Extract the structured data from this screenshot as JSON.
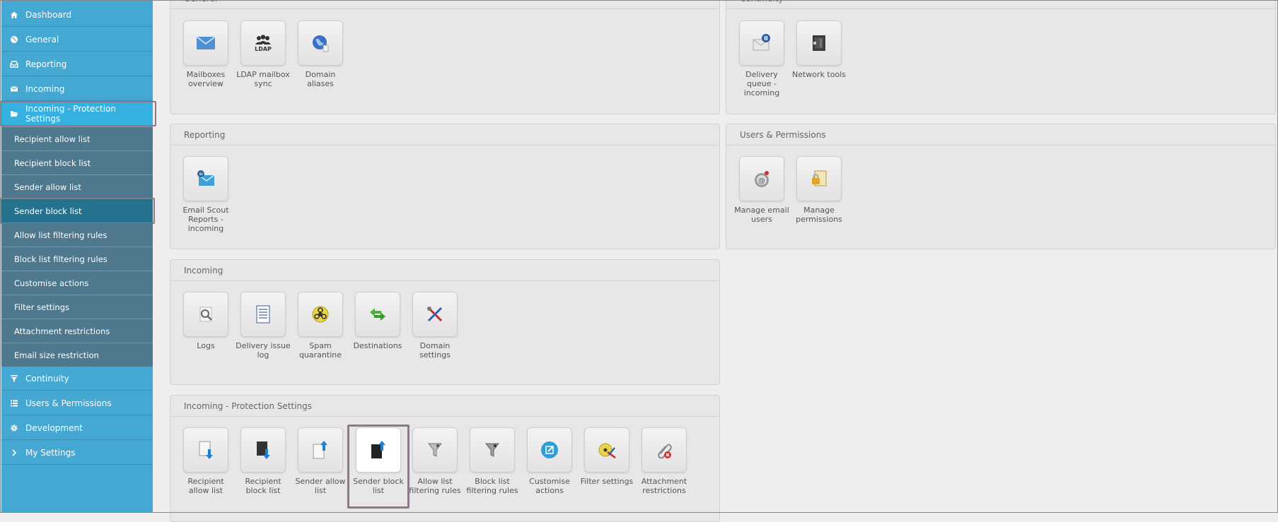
{
  "sidebar": {
    "top_items": [
      {
        "label": "Dashboard",
        "icon": "home-icon"
      },
      {
        "label": "General",
        "icon": "globe-icon"
      },
      {
        "label": "Reporting",
        "icon": "inbox-icon"
      },
      {
        "label": "Incoming",
        "icon": "envelope-icon"
      },
      {
        "label": "Incoming - Protection Settings",
        "icon": "folder-open-icon"
      }
    ],
    "sub_items": [
      "Recipient allow list",
      "Recipient block list",
      "Sender allow list",
      "Sender block list",
      "Allow list filtering rules",
      "Block list filtering rules",
      "Customise actions",
      "Filter settings",
      "Attachment restrictions",
      "Email size restriction"
    ],
    "bottom_items": [
      {
        "label": "Continuity",
        "icon": "filter-icon"
      },
      {
        "label": "Users & Permissions",
        "icon": "list-icon"
      },
      {
        "label": "Development",
        "icon": "gear-icon"
      },
      {
        "label": "My Settings",
        "icon": "chevron-right-icon"
      }
    ]
  },
  "panels": {
    "general": {
      "title": "General",
      "tiles": [
        {
          "label": "Mailboxes overview",
          "icon": "mailbox-icon"
        },
        {
          "label": "LDAP mailbox sync",
          "icon": "ldap-icon"
        },
        {
          "label": "Domain aliases",
          "icon": "globe-domain-icon"
        }
      ]
    },
    "continuity": {
      "title": "Continuity",
      "tiles": [
        {
          "label": "Delivery queue - incoming",
          "icon": "queue-envelope-icon"
        },
        {
          "label": "Network tools",
          "icon": "network-tools-icon"
        }
      ]
    },
    "reporting": {
      "title": "Reporting",
      "tiles": [
        {
          "label": "Email Scout Reports - incoming",
          "icon": "email-scout-icon"
        }
      ]
    },
    "users": {
      "title": "Users & Permissions",
      "tiles": [
        {
          "label": "Manage email users",
          "icon": "email-users-icon"
        },
        {
          "label": "Manage permissions",
          "icon": "permissions-icon"
        }
      ]
    },
    "incoming": {
      "title": "Incoming",
      "tiles": [
        {
          "label": "Logs",
          "icon": "magnifier-icon"
        },
        {
          "label": "Delivery issue log",
          "icon": "document-list-icon"
        },
        {
          "label": "Spam quarantine",
          "icon": "biohazard-icon"
        },
        {
          "label": "Destinations",
          "icon": "arrows-icon"
        },
        {
          "label": "Domain settings",
          "icon": "tools-icon"
        }
      ]
    },
    "protection": {
      "title": "Incoming - Protection Settings",
      "tiles": [
        {
          "label": "Recipient allow list",
          "icon": "doc-arrow-down-icon"
        },
        {
          "label": "Recipient block list",
          "icon": "dark-doc-arrow-down-icon"
        },
        {
          "label": "Sender allow list",
          "icon": "doc-arrow-up-icon"
        },
        {
          "label": "Sender block list",
          "icon": "dark-doc-arrow-up-icon"
        },
        {
          "label": "Allow list filtering rules",
          "icon": "funnel-icon"
        },
        {
          "label": "Block list filtering rules",
          "icon": "funnel-dark-icon"
        },
        {
          "label": "Customise actions",
          "icon": "edit-circle-icon"
        },
        {
          "label": "Filter settings",
          "icon": "biohazard-tools-icon"
        },
        {
          "label": "Attachment restrictions",
          "icon": "paperclip-block-icon"
        }
      ]
    }
  }
}
